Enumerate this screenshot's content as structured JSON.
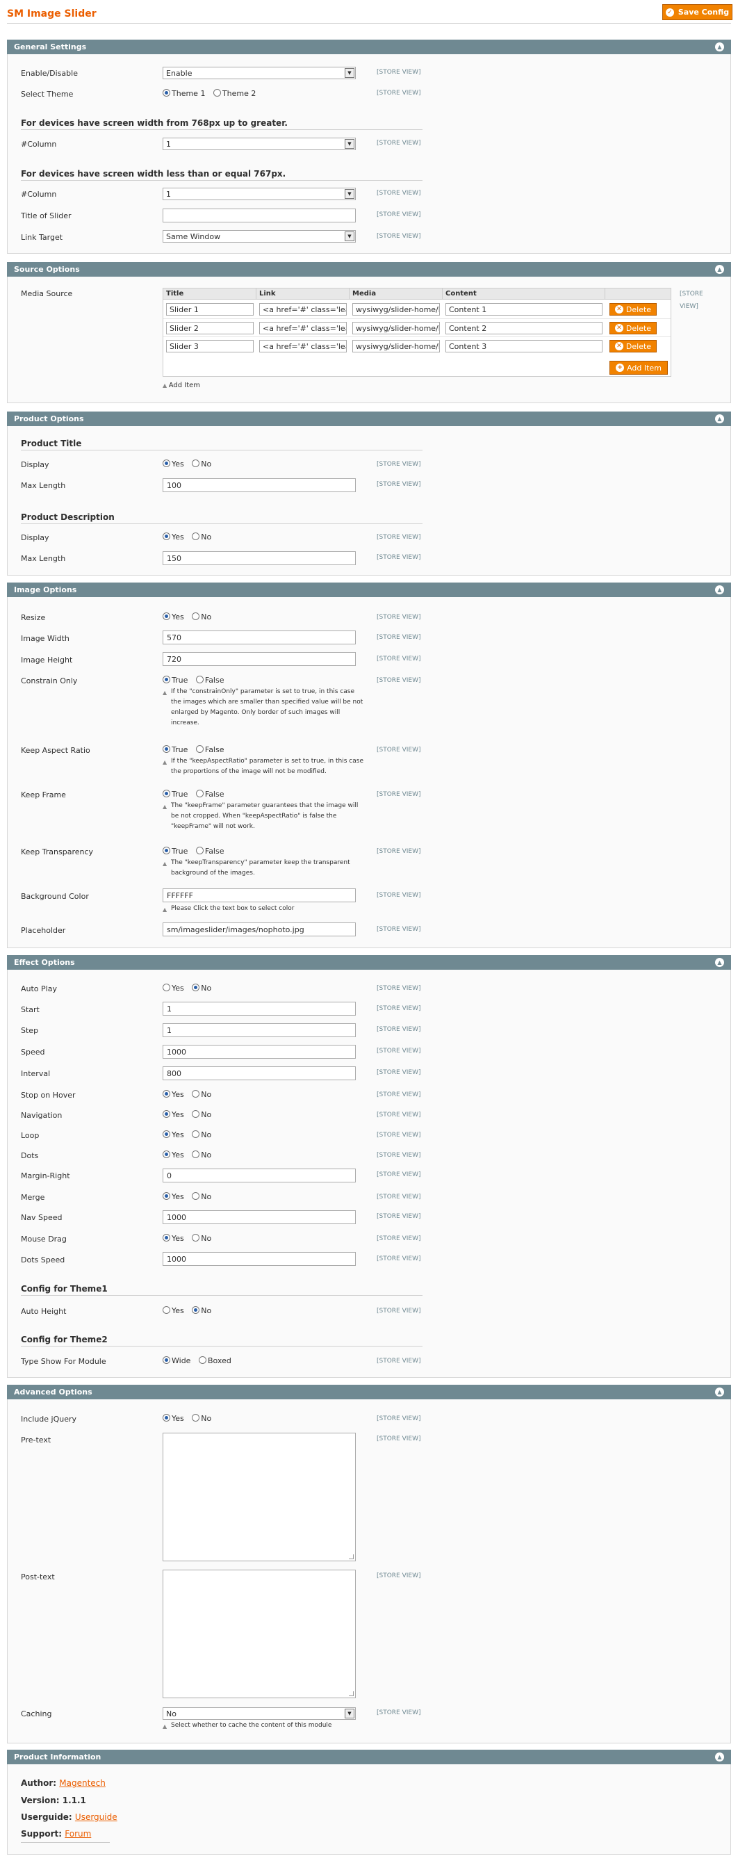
{
  "header": {
    "title": "SM Image Slider",
    "save_label": "Save Config"
  },
  "scope_label": "[STORE VIEW]",
  "general": {
    "title": "General Settings",
    "enable_label": "Enable/Disable",
    "enable_value": "Enable",
    "theme_label": "Select Theme",
    "theme_options": [
      "Theme 1",
      "Theme 2"
    ],
    "theme_selected": "Theme 1",
    "big_heading": "For devices have screen width from 768px up to greater.",
    "column_label": "#Column",
    "column_big_value": "1",
    "small_heading": "For devices have screen width less than or equal 767px.",
    "column_small_value": "1",
    "slider_title_label": "Title of Slider",
    "slider_title_value": "",
    "link_target_label": "Link Target",
    "link_target_value": "Same Window"
  },
  "source": {
    "title": "Source Options",
    "media_label": "Media Source",
    "scope_line1": "[STORE",
    "scope_line2": "VIEW]",
    "columns": [
      "Title",
      "Link",
      "Media",
      "Content"
    ],
    "rows": [
      {
        "title": "Slider 1",
        "link": "<a href='#' class='lear",
        "media": "wysiwyg/slider-home/l",
        "content": "Content 1"
      },
      {
        "title": "Slider 2",
        "link": "<a href='#' class='lear",
        "media": "wysiwyg/slider-home/l",
        "content": "Content 2"
      },
      {
        "title": "Slider 3",
        "link": "<a href='#' class='lear",
        "media": "wysiwyg/slider-home/l",
        "content": "Content 3"
      }
    ],
    "delete_label": "Delete",
    "add_item_label": "Add Item",
    "add_item_link": "Add Item"
  },
  "product": {
    "title": "Product Options",
    "title_heading": "Product Title",
    "display_label": "Display",
    "yes": "Yes",
    "no": "No",
    "max_length_label": "Max Length",
    "title_max_length": "100",
    "desc_heading": "Product Description",
    "desc_max_length": "150"
  },
  "image": {
    "title": "Image Options",
    "resize_label": "Resize",
    "width_label": "Image Width",
    "width_value": "570",
    "height_label": "Image Height",
    "height_value": "720",
    "constrain_label": "Constrain Only",
    "true_label": "True",
    "false_label": "False",
    "constrain_note": "If the \"constrainOnly\" parameter is set to true, in this case the images which are smaller than specified value will be not enlarged by Magento. Only border of such images will increase.",
    "aspect_label": "Keep Aspect Ratio",
    "aspect_note": "If the \"keepAspectRatio\" parameter is set to true, in this case the proportions of the image will not be modified.",
    "frame_label": "Keep Frame",
    "frame_note": "The \"keepFrame\" parameter guarantees that the image will be not cropped. When \"keepAspectRatio\" is false the \"keepFrame\" will not work.",
    "transparency_label": "Keep Transparency",
    "transparency_note": "The \"keepTransparency\" parameter keep the transparent background of the images.",
    "bg_label": "Background Color",
    "bg_value": "FFFFFF",
    "bg_note": "Please Click the text box to select color",
    "placeholder_label": "Placeholder",
    "placeholder_value": "sm/imageslider/images/nophoto.jpg"
  },
  "effect": {
    "title": "Effect Options",
    "autoplay_label": "Auto Play",
    "start_label": "Start",
    "start_value": "1",
    "step_label": "Step",
    "step_value": "1",
    "speed_label": "Speed",
    "speed_value": "1000",
    "interval_label": "Interval",
    "interval_value": "800",
    "hover_label": "Stop on Hover",
    "nav_label": "Navigation",
    "loop_label": "Loop",
    "dots_label": "Dots",
    "margin_label": "Margin-Right",
    "margin_value": "0",
    "merge_label": "Merge",
    "navspeed_label": "Nav Speed",
    "navspeed_value": "1000",
    "drag_label": "Mouse Drag",
    "dotsspeed_label": "Dots Speed",
    "dotsspeed_value": "1000",
    "theme1_heading": "Config for Theme1",
    "autoheight_label": "Auto Height",
    "theme2_heading": "Config for Theme2",
    "typeshow_label": "Type Show For Module",
    "wide_label": "Wide",
    "boxed_label": "Boxed"
  },
  "advanced": {
    "title": "Advanced Options",
    "jquery_label": "Include jQuery",
    "pretext_label": "Pre-text",
    "posttext_label": "Post-text",
    "caching_label": "Caching",
    "caching_value": "No",
    "caching_note": "Select whether to cache the content of this module"
  },
  "info": {
    "title": "Product Information",
    "author_label": "Author:",
    "author_value": "Magentech",
    "version_label": "Version:",
    "version_value": "1.1.1",
    "guide_label": "Userguide:",
    "guide_value": "Userguide",
    "support_label": "Support:",
    "support_value": "Forum"
  },
  "colors": {
    "accent": "#eb5e00",
    "button": "#f18200",
    "section_header": "#6f8992",
    "radio_selected": "#2a5fa8"
  },
  "icons": {
    "save": "check-circle-icon",
    "delete": "x-circle-icon",
    "add": "plus-circle-icon",
    "toggle": "collapse-up-icon"
  }
}
